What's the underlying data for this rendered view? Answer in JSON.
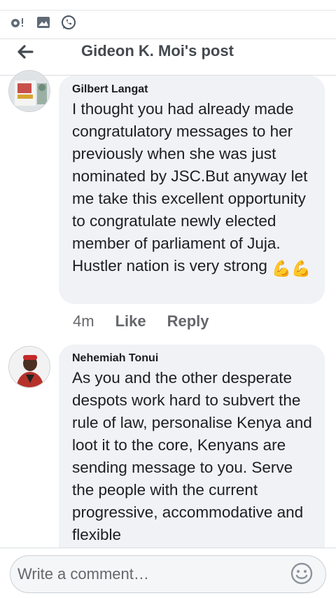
{
  "status_bar": {
    "icons": [
      "notification-icon",
      "gallery-icon",
      "whatsapp-icon"
    ]
  },
  "header": {
    "title": "Gideon K. Moi's post",
    "back_icon": "arrow-left-icon"
  },
  "comments": [
    {
      "author": "Gilbert Langat",
      "text": "I thought you had already made congratulatory messages to her previously when she was just nominated by JSC.But anyway let me take this excellent opportunity to congratulate newly elected member of parliament of Juja. Hustler nation is very strong",
      "emoji": "💪💪",
      "time": "4m",
      "like_label": "Like",
      "reply_label": "Reply"
    },
    {
      "author": "Nehemiah Tonui",
      "text": "As you and the other desperate despots work hard to subvert the rule of law, personalise Kenya and loot it to the core, Kenyans are sending message to you. Serve the people with the current progressive, accommodative and flexible"
    }
  ],
  "composer": {
    "placeholder": "Write a comment…",
    "emoji_icon": "smiley-icon"
  },
  "colors": {
    "bubble": "#f0f2f5",
    "secondary_text": "#65676b",
    "title_text": "#444950"
  }
}
